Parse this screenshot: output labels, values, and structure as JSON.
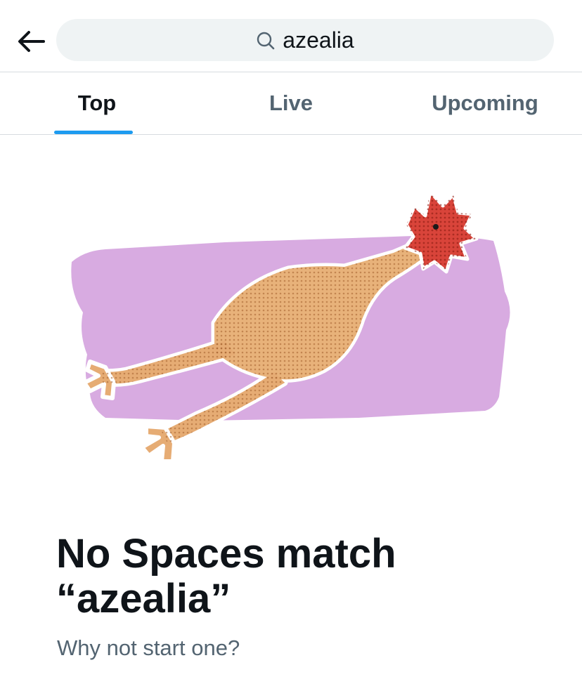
{
  "search": {
    "query": "azealia"
  },
  "tabs": [
    {
      "label": "Top",
      "active": true
    },
    {
      "label": "Live",
      "active": false
    },
    {
      "label": "Upcoming",
      "active": false
    }
  ],
  "empty_state": {
    "title": "No Spaces match “azealia”",
    "subtitle": "Why not start one?",
    "illustration": "rubber-chicken-illustration"
  },
  "colors": {
    "accent": "#1d9bf0",
    "text_primary": "#0f1419",
    "text_secondary": "#536471",
    "search_bg": "#eff3f4",
    "illustration_bg": "#d8abe1"
  }
}
